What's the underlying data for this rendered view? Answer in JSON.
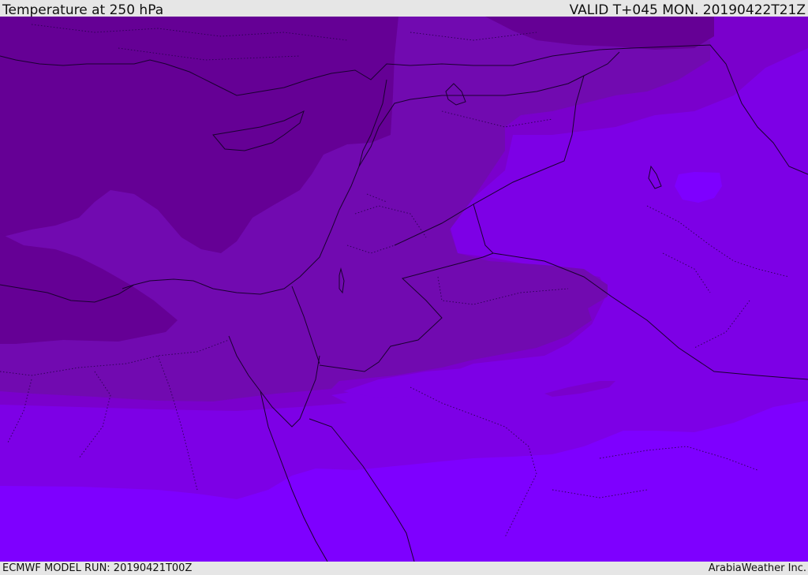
{
  "header": {
    "field_title": "Temperature at 250 hPa",
    "valid_label": "VALID T+045 MON. 20190422T21Z"
  },
  "footer": {
    "model_run": "ECMWF MODEL RUN: 20190421T00Z",
    "provider": "ArabiaWeather Inc."
  },
  "map": {
    "field": "temperature-250hPa",
    "region": "Eastern Mediterranean / Middle East",
    "colors": {
      "level_coldest": "#650095",
      "level_cold": "#710ab0",
      "level_mid": "#7a00cc",
      "level_warm": "#7d00e6",
      "level_warmest": "#7e00ff",
      "coastline": "#1a0030"
    }
  }
}
